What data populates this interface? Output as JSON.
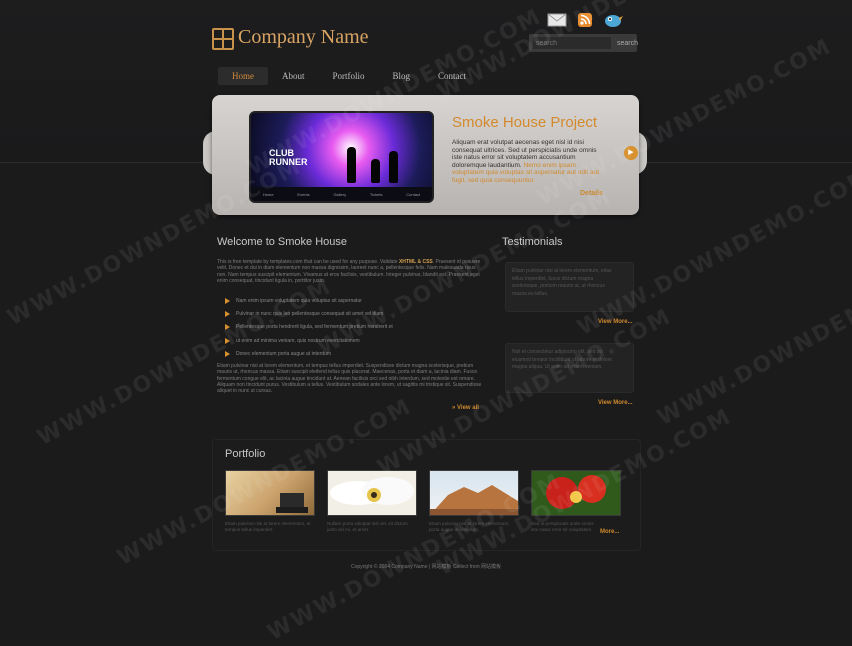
{
  "header": {
    "company_name": "Company Name",
    "search": {
      "placeholder": "search",
      "button_label": "search"
    },
    "top_icons": [
      "mail-icon",
      "rss-icon",
      "twitter-bird-icon"
    ]
  },
  "nav": {
    "items": [
      {
        "label": "Home",
        "active": true
      },
      {
        "label": "About",
        "active": false
      },
      {
        "label": "Portfolio",
        "active": false
      },
      {
        "label": "Blog",
        "active": false
      },
      {
        "label": "Contact",
        "active": false
      }
    ]
  },
  "featured": {
    "image_title_line1": "CLUB",
    "image_title_line2": "RUNNER",
    "image_bar_items": [
      "Home",
      "Events",
      "Gallery",
      "Tickets",
      "Contact"
    ],
    "title": "Smoke House Project",
    "text": "Aliquam erat volutpat aecenas eget nisl id nisi consequat ultrices. Sed ut perspiciatis unde omnis iste natus error sit voluptatem accusantium doloremque laudantium.",
    "text_highlight": "Nemo enim ipsam voluptatem quia voluptas sit aspernatur aut odit aut fugit, sed quia consequuntur.",
    "details_label": "Details"
  },
  "welcome": {
    "title": "Welcome to Smoke House",
    "intro": "This is free template by templates.com that can be used for any purpose. Validate",
    "intro_bold": "XHTML & CSS",
    "intro_rest": ". Praesent id posuere velit. Donec et dui in diam elementum non massa dignissim, laoreet nunc a, pellentesque felis. Nam malesuada risus non. Nam tempus suscipit elementum. Vivamus at eros facilisis, vestibulum. Integer pulvinar, blandit est. Praesent eget enim consequat, tincidunt ligula in, porttitor justo.",
    "bullets": [
      "Nam enim ipsum voluptatem quia voluptas sit aspernatur",
      "Pulvinar in nunc quis leo pellentesque consequat sit amet vel diam",
      "Pellentesque porta hendrerit ligula, sed fermentum pretium hendrerit et",
      "ut enim ad minima veniam, quis nostrum exercitationem",
      "Donec elementum porta augue at interdum"
    ],
    "body": "Etiam pulvinar nisi at lorem elementum, et tempus tellus imperdiet. Suspendisse dictum magna scelerisque, pretium mauris ut, rhoncus massa. Etiam suscipit eleifend tellus quis placerat. Maecenas, porta et diam a, lacinia diam. Fusce fermentum congue elit, ac lacinia augue tincidunt at. Aenean facilisis orci sed nibh interdum, sed molestie est ornare. Aliquam non tincidunt purus. Vestibulum a tellus. Vestibulum sodales ante lorem, ut sagittis mi tristique sit. Suspendisse aliquet in nunc ut cursus.",
    "view_all_label": "» View all"
  },
  "testimonials": {
    "title": "Testimonials",
    "items": [
      {
        "text": "Etiam pulvinar nisi at lorem elementum, eitas tellus imperdiet, fusce dictum magna scelerisque, pretium mauris ut, ut rhoncus massa eu tellus.",
        "more": "View More..."
      },
      {
        "text": "Nisl et consectetur adipiscing elit, sed do eiusmod tempor incididunt ut labore et dolore magna aliqua. Ut enim ad minim veniam.",
        "more": "View More..."
      }
    ]
  },
  "portfolio": {
    "title": "Portfolio",
    "items": [
      {
        "caption": "Etiam pulvinar nisi at lorem elementum, et tempus tellus imperdiet."
      },
      {
        "caption": "Nullam porta volutpat nisl vel, sit dictum justo vel mi, et amet."
      },
      {
        "caption": "Etiam pulvinar nisi at lorem elementum, porta augue at interdum."
      },
      {
        "caption": "Sed ut perspiciatis unde omnis iste natus error sit voluptatem."
      }
    ],
    "more_label": "More..."
  },
  "footer": {
    "text": "Copyright © 2084 Company Name | 网站模板  Collect from 网站模板"
  },
  "watermark": "WWW.DOWNDEMO.COM",
  "colors": {
    "accent": "#d8912f",
    "background": "#1b1b1c",
    "slider": "#c9c6c3"
  }
}
